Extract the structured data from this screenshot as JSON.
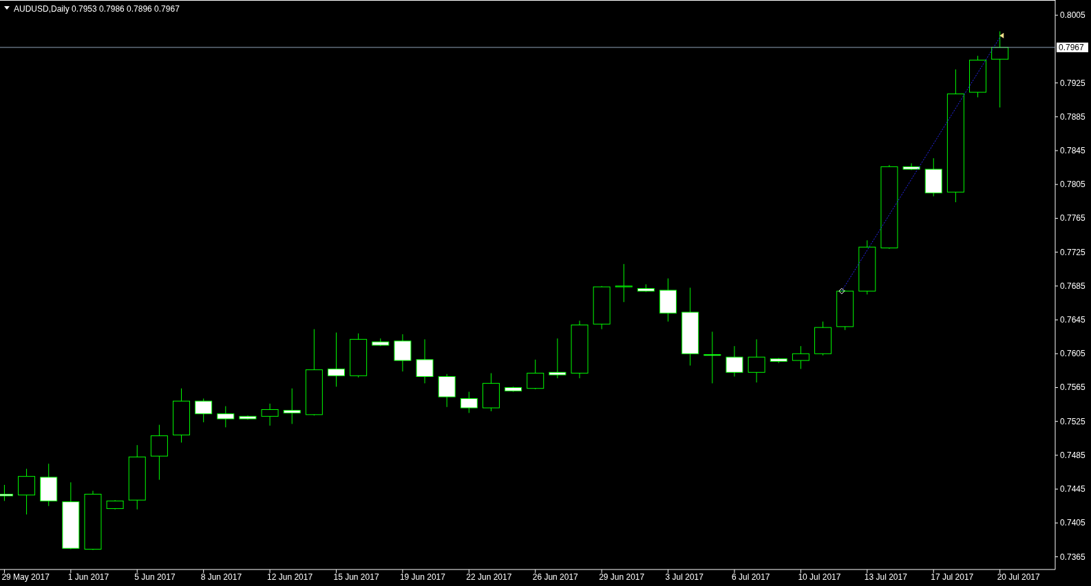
{
  "header": {
    "symbol": "AUDUSD,Daily",
    "ohlc": "0.7953 0.7986 0.7896 0.7967"
  },
  "price_axis": [
    "0.8005",
    "0.7925",
    "0.7885",
    "0.7845",
    "0.7805",
    "0.7765",
    "0.7725",
    "0.7685",
    "0.7645",
    "0.7605",
    "0.7565",
    "0.7525",
    "0.7485",
    "0.7445",
    "0.7405",
    "0.7365"
  ],
  "current_price": "0.7967",
  "date_axis": [
    "29 May 2017",
    "1 Jun 2017",
    "5 Jun 2017",
    "8 Jun 2017",
    "12 Jun 2017",
    "15 Jun 2017",
    "19 Jun 2017",
    "22 Jun 2017",
    "26 Jun 2017",
    "29 Jun 2017",
    "3 Jul 2017",
    "6 Jul 2017",
    "10 Jul 2017",
    "13 Jul 2017",
    "17 Jul 2017",
    "20 Jul 2017"
  ]
}
